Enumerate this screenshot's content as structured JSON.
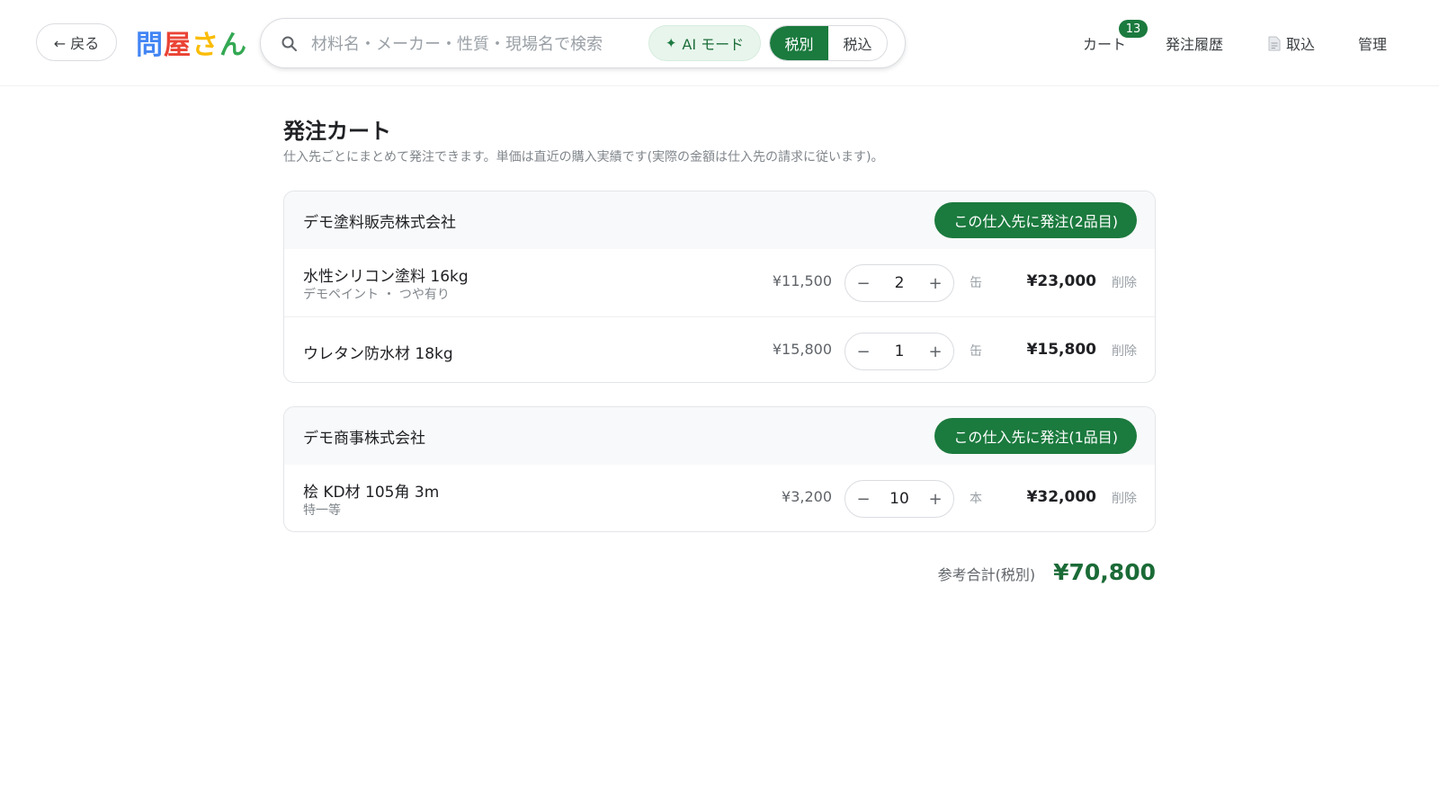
{
  "header": {
    "back_label": "← 戻る",
    "logo": [
      {
        "char": "問",
        "color": "#4285F4"
      },
      {
        "char": "屋",
        "color": "#EA4335"
      },
      {
        "char": "さ",
        "color": "#FBBC05"
      },
      {
        "char": "ん",
        "color": "#34A853"
      }
    ],
    "search": {
      "placeholder": "材料名・メーカー・性質・現場名で検索",
      "value": "",
      "icon": "search-icon"
    },
    "ai_mode_label": "AI モード",
    "tax_toggle": {
      "options": [
        "税別",
        "税込"
      ],
      "selected": "税別"
    },
    "nav": {
      "cart_label": "カート",
      "cart_count": "13",
      "history_label": "発注履歴",
      "import_label": "取込",
      "import_icon": "document-icon",
      "admin_label": "管理"
    }
  },
  "page": {
    "title": "発注カート",
    "subtitle": "仕入先ごとにまとめて発注できます。単価は直近の購入実績です(実際の金額は仕入先の請求に従います)。"
  },
  "suppliers": [
    {
      "name": "デモ塗料販売株式会社",
      "order_label": "この仕入先に発注(2品目)",
      "items": [
        {
          "name": "水性シリコン塗料 16kg",
          "sub": "デモペイント ・ つや有り",
          "unit_price": "¥11,500",
          "qty": "2",
          "unit": "缶",
          "total": "¥23,000",
          "delete": "削除"
        },
        {
          "name": "ウレタン防水材 18kg",
          "sub": "",
          "unit_price": "¥15,800",
          "qty": "1",
          "unit": "缶",
          "total": "¥15,800",
          "delete": "削除"
        }
      ]
    },
    {
      "name": "デモ商事株式会社",
      "order_label": "この仕入先に発注(1品目)",
      "items": [
        {
          "name": "桧 KD材 105角 3m",
          "sub": "特一等",
          "unit_price": "¥3,200",
          "qty": "10",
          "unit": "本",
          "total": "¥32,000",
          "delete": "削除"
        }
      ]
    }
  ],
  "stepper": {
    "minus": "−",
    "plus": "+"
  },
  "summary": {
    "label": "参考合計(税別)",
    "total": "¥70,800"
  },
  "colors": {
    "accent": "#1b7a3e",
    "accent_light": "#e8f5ec",
    "total_text": "#1b6b37"
  }
}
